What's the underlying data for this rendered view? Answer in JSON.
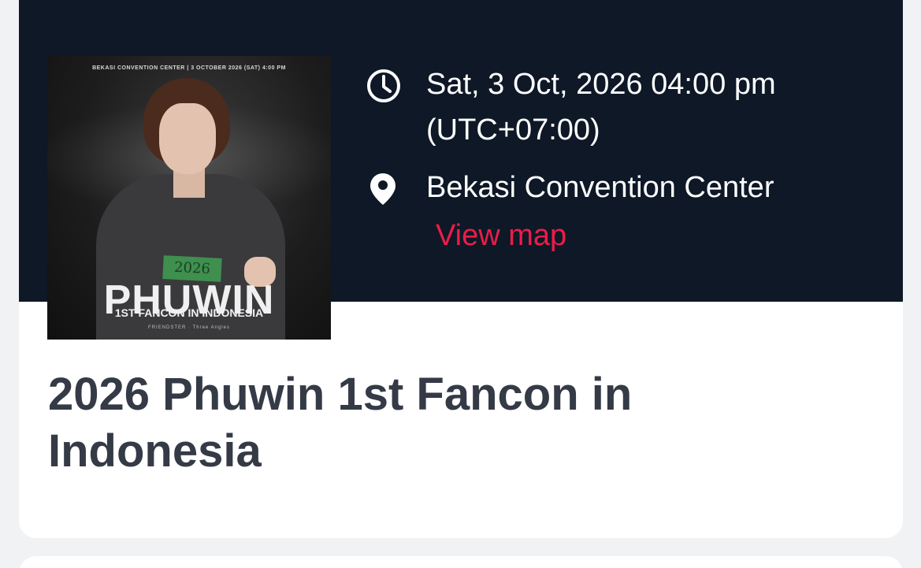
{
  "poster": {
    "topline": "BEKASI CONVENTION CENTER | 3 OCTOBER 2026 (SAT) 4:00 PM",
    "tag": "2026",
    "headline": "PHUWIN",
    "subline": "1ST FANCON IN INDONESIA",
    "sponsors": "FRIENDSTER · Three Angles"
  },
  "event": {
    "datetime": "Sat, 3 Oct, 2026 04:00 pm (UTC+07:00)",
    "venue": "Bekasi Convention Center",
    "view_map_label": "View map",
    "title": "2026 Phuwin 1st Fancon in Indonesia"
  },
  "colors": {
    "hero_bg": "#0e1826",
    "accent": "#ec1c4a",
    "title_text": "#343a46"
  },
  "icons": {
    "time": "clock-icon",
    "location": "map-pin-icon"
  }
}
